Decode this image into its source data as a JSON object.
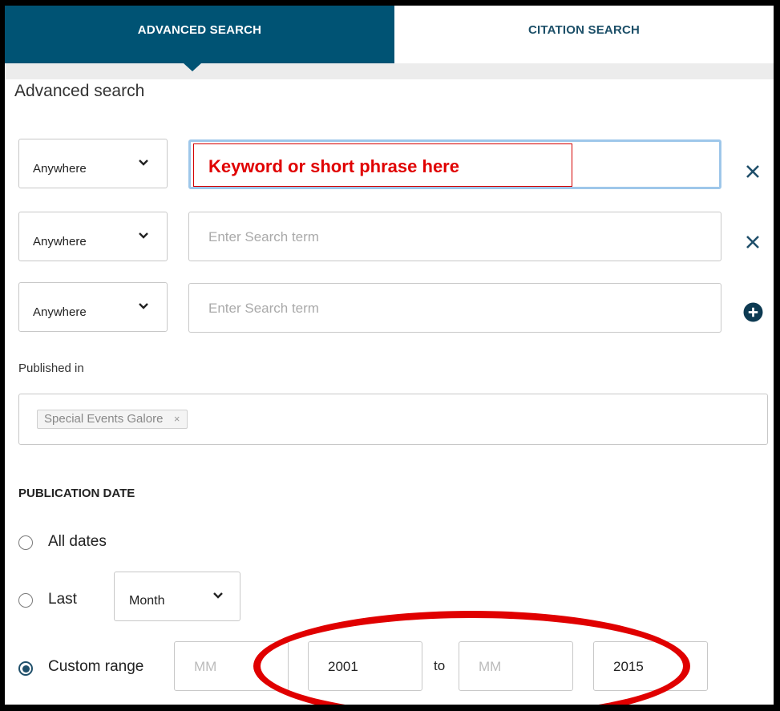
{
  "tabs": [
    {
      "label": "ADVANCED SEARCH",
      "active": true
    },
    {
      "label": "CITATION SEARCH",
      "active": false
    }
  ],
  "title": "Advanced search",
  "search_rows": [
    {
      "field": "Anywhere",
      "value": "Keyword or short phrase here",
      "placeholder": "Enter Search term",
      "action_icon": "close-icon"
    },
    {
      "field": "Anywhere",
      "value": "",
      "placeholder": "Enter Search term",
      "action_icon": "close-icon"
    },
    {
      "field": "Anywhere",
      "value": "",
      "placeholder": "Enter Search term",
      "action_icon": "add-circle-icon"
    }
  ],
  "published_in": {
    "label": "Published in",
    "chips": [
      {
        "label": "Special Events Galore",
        "remove": "×"
      }
    ]
  },
  "publication_date": {
    "heading": "PUBLICATION DATE",
    "options": [
      {
        "label": "All dates",
        "selected": false
      },
      {
        "label": "Last",
        "selected": false,
        "unit": "Month"
      },
      {
        "label": "Custom range",
        "selected": true
      }
    ],
    "range": {
      "from_month_placeholder": "MM",
      "from_year": "2001",
      "separator": "to",
      "to_month_placeholder": "MM",
      "to_year": "2015"
    }
  },
  "colors": {
    "tab_active_bg": "#005374",
    "accent": "#1f4f6a",
    "annotation_red": "#e00000"
  }
}
